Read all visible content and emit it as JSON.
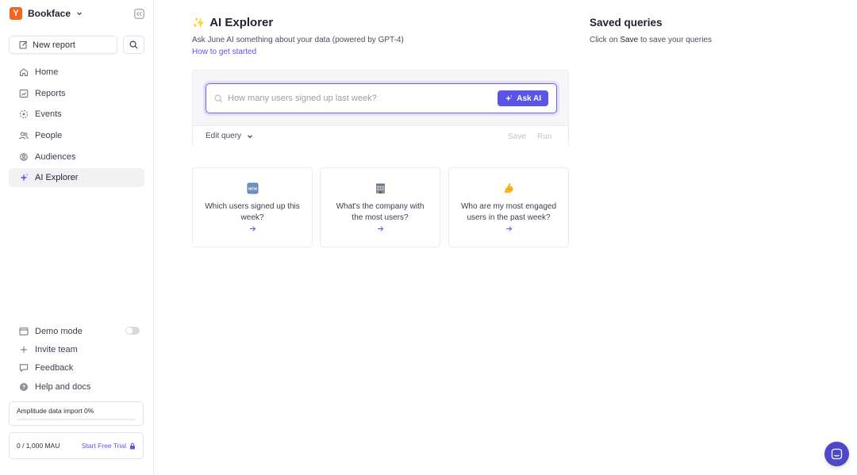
{
  "workspace": {
    "logo_letter": "Y",
    "name": "Bookface"
  },
  "sidebar": {
    "new_report_label": "New report",
    "nav": [
      {
        "label": "Home",
        "icon": "home-icon"
      },
      {
        "label": "Reports",
        "icon": "reports-icon"
      },
      {
        "label": "Events",
        "icon": "events-icon"
      },
      {
        "label": "People",
        "icon": "people-icon"
      },
      {
        "label": "Audiences",
        "icon": "audiences-icon"
      },
      {
        "label": "AI Explorer",
        "icon": "sparkle-icon",
        "active": true
      }
    ],
    "bottom": [
      {
        "label": "Demo mode",
        "icon": "window-icon",
        "toggle": false
      },
      {
        "label": "Invite team",
        "icon": "plus-icon"
      },
      {
        "label": "Feedback",
        "icon": "feedback-icon"
      },
      {
        "label": "Help and docs",
        "icon": "help-icon"
      }
    ],
    "import": {
      "label": "Amplitude data import 0%",
      "progress": 0.0
    },
    "mau": {
      "label": "0 / 1,000 MAU",
      "trial_label": "Start Free Trial"
    }
  },
  "main": {
    "title_emoji": "✨",
    "title": "AI Explorer",
    "subtitle": "Ask June AI something about your data (powered by GPT-4)",
    "how_to_link": "How to get started",
    "query": {
      "placeholder": "How many users signed up last week?",
      "value": "",
      "ask_label": "Ask AI",
      "edit_label": "Edit query",
      "save_label": "Save",
      "run_label": "Run"
    },
    "suggestions": [
      {
        "text": "Which users signed up this week?",
        "icon": "new-badge-icon"
      },
      {
        "text": "What's the company with the most users?",
        "icon": "office-building-icon"
      },
      {
        "text": "Who are my most engaged users in the past week?",
        "icon": "flexed-biceps-icon"
      }
    ]
  },
  "saved": {
    "title": "Saved queries",
    "hint_prefix": "Click on",
    "hint_keyword": "Save",
    "hint_suffix": "to save your queries"
  },
  "colors": {
    "accent": "#5b54e8",
    "workspace_logo": "#f26522",
    "chat_button": "#4e47c8"
  }
}
